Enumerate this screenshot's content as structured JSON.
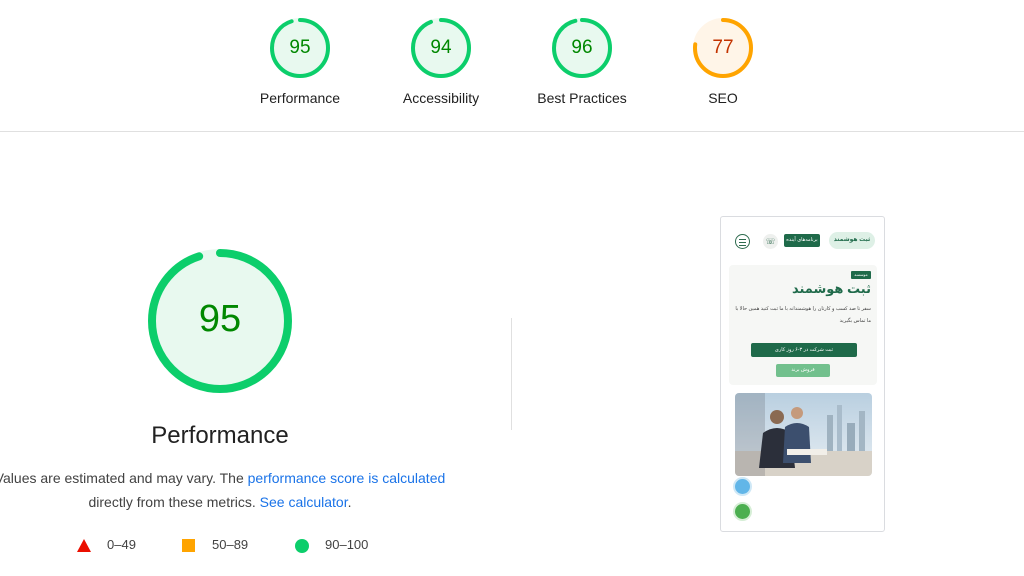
{
  "summary": {
    "gauges": [
      {
        "label": "Performance",
        "score": "95",
        "value": 95,
        "color": "#0cce6b",
        "text_color": "#008800",
        "fill": "#e8f9ef"
      },
      {
        "label": "Accessibility",
        "score": "94",
        "value": 94,
        "color": "#0cce6b",
        "text_color": "#008800",
        "fill": "#e8f9ef"
      },
      {
        "label": "Best Practices",
        "score": "96",
        "value": 96,
        "color": "#0cce6b",
        "text_color": "#008800",
        "fill": "#e8f9ef"
      },
      {
        "label": "SEO",
        "score": "77",
        "value": 77,
        "color": "#ffa400",
        "text_color": "#c33300",
        "fill": "#fff5e8"
      }
    ]
  },
  "performance": {
    "score": "95",
    "value": 95,
    "title": "Performance",
    "desc_prefix": "Values are estimated and may vary. The ",
    "desc_link": "performance score is calculated",
    "desc_middle": "directly from these metrics. ",
    "desc_calc_link": "See calculator",
    "desc_suffix": ".",
    "colors": {
      "ring": "#0cce6b",
      "text": "#008800",
      "fill": "#e8f9ef",
      "link": "#1a73e8"
    }
  },
  "legend": [
    {
      "shape": "triangle",
      "range": "0–49",
      "color": "#eb0f00"
    },
    {
      "shape": "square",
      "range": "50–89",
      "color": "#ffa400"
    },
    {
      "shape": "circle",
      "range": "90–100",
      "color": "#0cce6b"
    }
  ],
  "screenshot": {
    "header_button": "برنامه‌های آینده",
    "logo": "ثبت هوشمند",
    "tag": "موسسه",
    "title": "ثبت هوشمند",
    "text": "سفر تا صد کسب و کارتان را هوشمندانه با ما ثبت کنید همین حالا با ما تماس بگیرید",
    "cta_primary": "ثبت شرکت در ۳-۶ روز کاری",
    "cta_secondary": "فروش برند"
  }
}
